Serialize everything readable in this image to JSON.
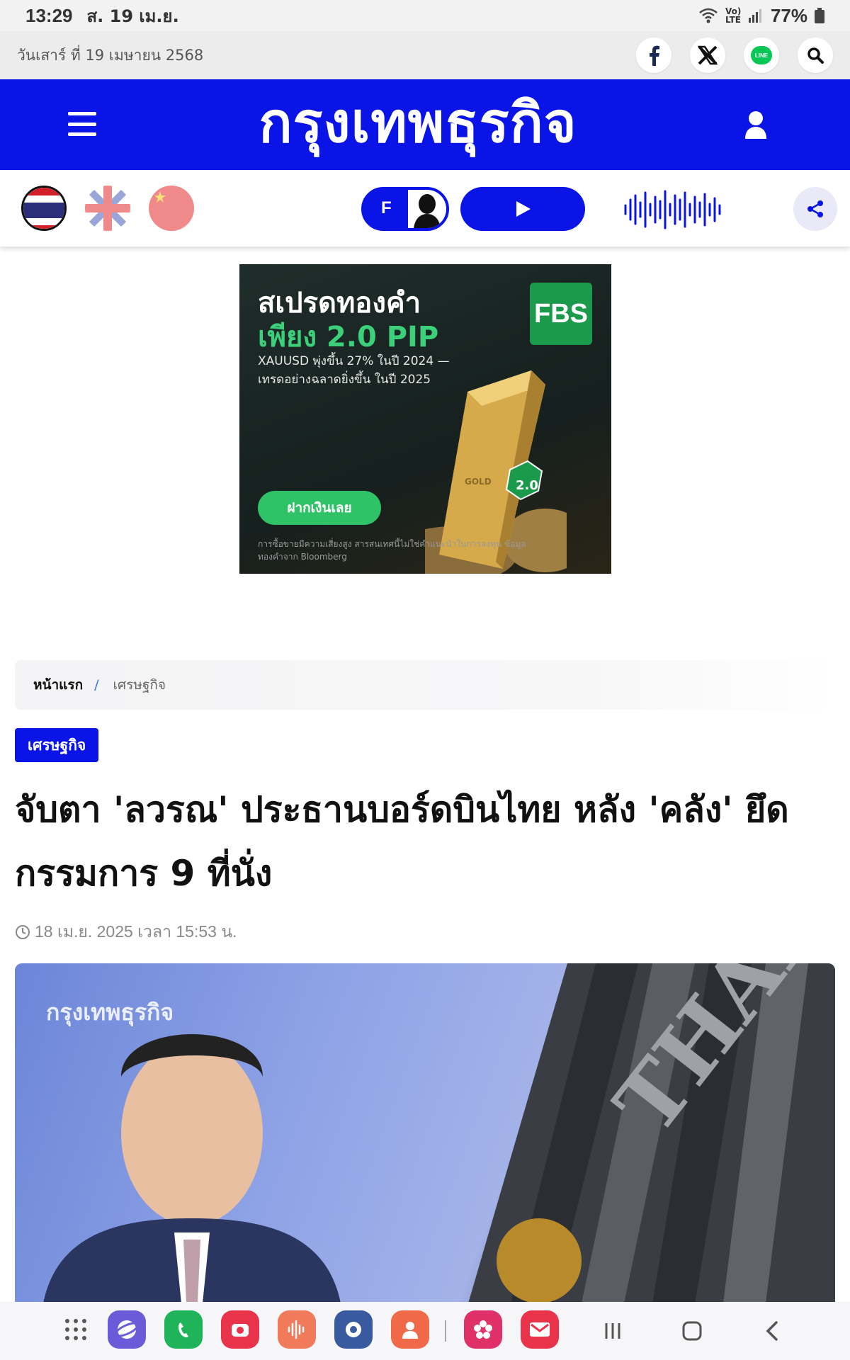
{
  "status_bar": {
    "time": "13:29",
    "date": "ส. 19 เม.ย.",
    "network": "Vo) LTE",
    "battery": "77%"
  },
  "top_bar": {
    "date_text": "วันเสาร์ ที่ 19 เมษายน 2568",
    "social": [
      "facebook-icon",
      "x-icon",
      "line-icon",
      "search-icon"
    ],
    "line_label": "LINE"
  },
  "header": {
    "logo_text": "กรุงเทพธุรกิจ",
    "brand_color": "#0a14e6"
  },
  "subbar": {
    "languages": [
      "thai-flag-icon",
      "uk-flag-icon",
      "china-flag-icon"
    ],
    "f_label": "F"
  },
  "ad": {
    "headline_1": "สเปรดทองคำ",
    "headline_2": "เพียง 2.0 PIP",
    "body": "XAUUSD พุ่งขึ้น 27% ในปี 2024 — เทรดอย่างฉลาดยิ่งขึ้น ในปี 2025",
    "brand": "FBS",
    "cta": "ฝากเงินเลย",
    "disclaimer": "การซื้อขายมีความเสี่ยงสูง สารสนเทศนี้ไม่ใช่คำแนะนำในการลงทุน ข้อมูลทองคำจาก Bloomberg",
    "bar_text": "GOLD",
    "badge": "2.0"
  },
  "breadcrumb": {
    "home": "หน้าแรก",
    "separator": "/",
    "current": "เศรษฐกิจ"
  },
  "article": {
    "category": "เศรษฐกิจ",
    "headline": "จับตา 'ลวรณ' ประธานบอร์ดบินไทย หลัง 'คลัง' ยึดกรรมการ 9 ที่นั่ง",
    "timestamp": "18 เม.ย. 2025 เวลา 15:53 น.",
    "image_watermark": "กรุงเทพธุรกิจ",
    "image_sign": "THAI"
  },
  "nav_bar": {
    "apps": [
      "apps-grid-icon",
      "internet-icon",
      "phone-icon",
      "camera-icon",
      "voice-recorder-icon",
      "settings-icon",
      "contacts-icon",
      "gallery-icon",
      "email-icon"
    ],
    "buttons": [
      "recents-icon",
      "home-icon",
      "back-icon"
    ]
  }
}
